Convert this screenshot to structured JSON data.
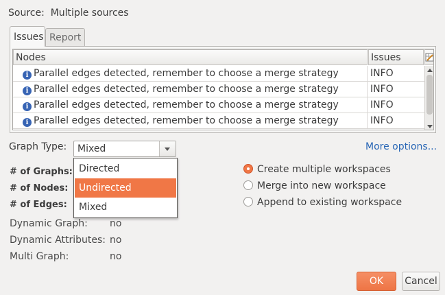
{
  "source": {
    "label": "Source:",
    "value": "Multiple sources"
  },
  "tabs": [
    {
      "label": "Issues",
      "active": true
    },
    {
      "label": "Report",
      "active": false
    }
  ],
  "issues_table": {
    "columns": [
      "Nodes",
      "Issues"
    ],
    "rows": [
      {
        "message": "Parallel edges detected, remember to choose a merge strategy",
        "level": "INFO",
        "icon": "info-icon"
      },
      {
        "message": "Parallel edges detected, remember to choose a merge strategy",
        "level": "INFO",
        "icon": "info-icon"
      },
      {
        "message": "Parallel edges detected, remember to choose a merge strategy",
        "level": "INFO",
        "icon": "info-icon"
      },
      {
        "message": "Parallel edges detected, remember to choose a merge strategy",
        "level": "INFO",
        "icon": "info-icon"
      }
    ]
  },
  "graph_type": {
    "label": "Graph Type:",
    "selected": "Mixed",
    "options": [
      "Directed",
      "Undirected",
      "Mixed"
    ],
    "highlighted": "Undirected"
  },
  "more_options": "More options...",
  "stats": {
    "graphs_label": "# of Graphs:",
    "nodes_label": "# of Nodes:",
    "edges_label": "# of Edges:"
  },
  "properties": [
    {
      "label": "Dynamic Graph:",
      "value": "no"
    },
    {
      "label": "Dynamic Attributes:",
      "value": "no"
    },
    {
      "label": "Multi Graph:",
      "value": "no"
    }
  ],
  "workspace_options": [
    {
      "label": "Create multiple workspaces",
      "checked": true
    },
    {
      "label": "Merge into new workspace",
      "checked": false
    },
    {
      "label": "Append to existing workspace",
      "checked": false
    }
  ],
  "buttons": {
    "ok": "OK",
    "cancel": "Cancel"
  },
  "colors": {
    "accent": "#f07746",
    "link": "#2a67b6",
    "info_icon": "#3764b4"
  }
}
